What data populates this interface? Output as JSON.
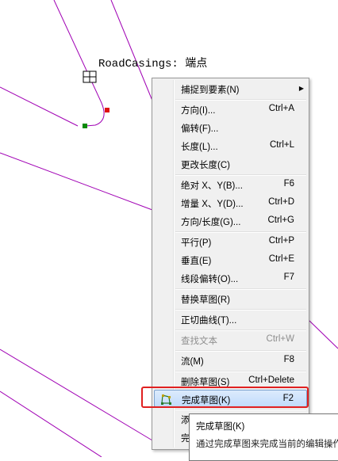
{
  "snap_tip": "RoadCasings: 端点",
  "menu": {
    "items": [
      {
        "label": "捕捉到要素(N)",
        "shortcut": ""
      },
      {
        "label": "方向(I)...",
        "shortcut": "Ctrl+A"
      },
      {
        "label": "偏转(F)...",
        "shortcut": ""
      },
      {
        "label": "长度(L)...",
        "shortcut": "Ctrl+L"
      },
      {
        "label": "更改长度(C)",
        "shortcut": ""
      },
      {
        "label": "绝对 X、Y(B)...",
        "shortcut": "F6"
      },
      {
        "label": "增量 X、Y(D)...",
        "shortcut": "Ctrl+D"
      },
      {
        "label": "方向/长度(G)...",
        "shortcut": "Ctrl+G"
      },
      {
        "label": "平行(P)",
        "shortcut": "Ctrl+P"
      },
      {
        "label": "垂直(E)",
        "shortcut": "Ctrl+E"
      },
      {
        "label": "线段偏转(O)...",
        "shortcut": "F7"
      },
      {
        "label": "替换草图(R)",
        "shortcut": ""
      },
      {
        "label": "正切曲线(T)...",
        "shortcut": ""
      },
      {
        "label": "查找文本",
        "shortcut": "Ctrl+W"
      },
      {
        "label": "流(M)",
        "shortcut": "F8"
      },
      {
        "label": "删除草图(S)",
        "shortcut": "Ctrl+Delete"
      },
      {
        "label": "完成草图(K)",
        "shortcut": "F2"
      },
      {
        "label": "添",
        "shortcut": ""
      },
      {
        "label": "完",
        "shortcut": ""
      }
    ]
  },
  "tooltip": {
    "title": "完成草图(K)",
    "description": "通过完成草图来完成当前的编辑操作"
  },
  "icons": {
    "finish_sketch": "finish-sketch-icon",
    "submenu": "submenu-arrow-icon",
    "snap_cursor": "snap-crosshair-icon"
  },
  "colors": {
    "line": "#a000b4",
    "vertex_start": "#0a8a0a",
    "vertex_end": "#e01010",
    "highlight_frame": "#e02020"
  }
}
